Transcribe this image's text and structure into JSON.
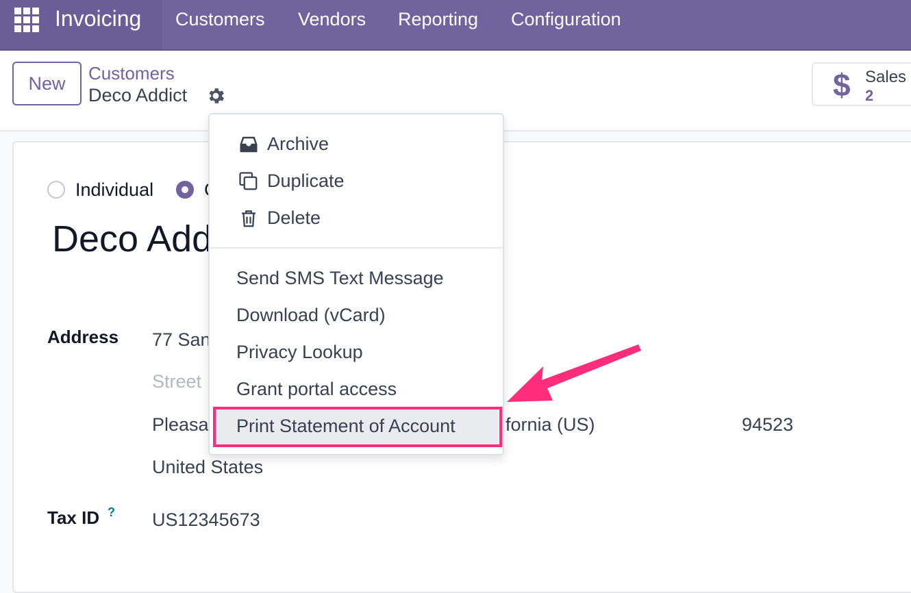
{
  "navbar": {
    "brand": "Invoicing",
    "menu": [
      "Customers",
      "Vendors",
      "Reporting",
      "Configuration"
    ]
  },
  "control": {
    "new_label": "New",
    "breadcrumb_parent": "Customers",
    "breadcrumb_current": "Deco Addict",
    "stat": {
      "label": "Sales",
      "value": "2"
    }
  },
  "form": {
    "radio_individual": "Individual",
    "radio_company_partial": "C",
    "name_visible": "Deco Add",
    "address_label": "Address",
    "street_partial": "77 San",
    "street2_placeholder": "Street",
    "city_partial": "Pleasa",
    "state_partial": "fornia (US)",
    "zip": "94523",
    "country": "United States",
    "tax_label": "Tax ID",
    "tax_help": "?",
    "tax_value": "US12345673"
  },
  "dropdown": {
    "items_top": [
      "Archive",
      "Duplicate",
      "Delete"
    ],
    "items_bottom": [
      "Send SMS Text Message",
      "Download (vCard)",
      "Privacy Lookup",
      "Grant portal access",
      "Print Statement of Account"
    ]
  },
  "colors": {
    "brand": "#71639e",
    "annotation": "#ff2d7a"
  }
}
